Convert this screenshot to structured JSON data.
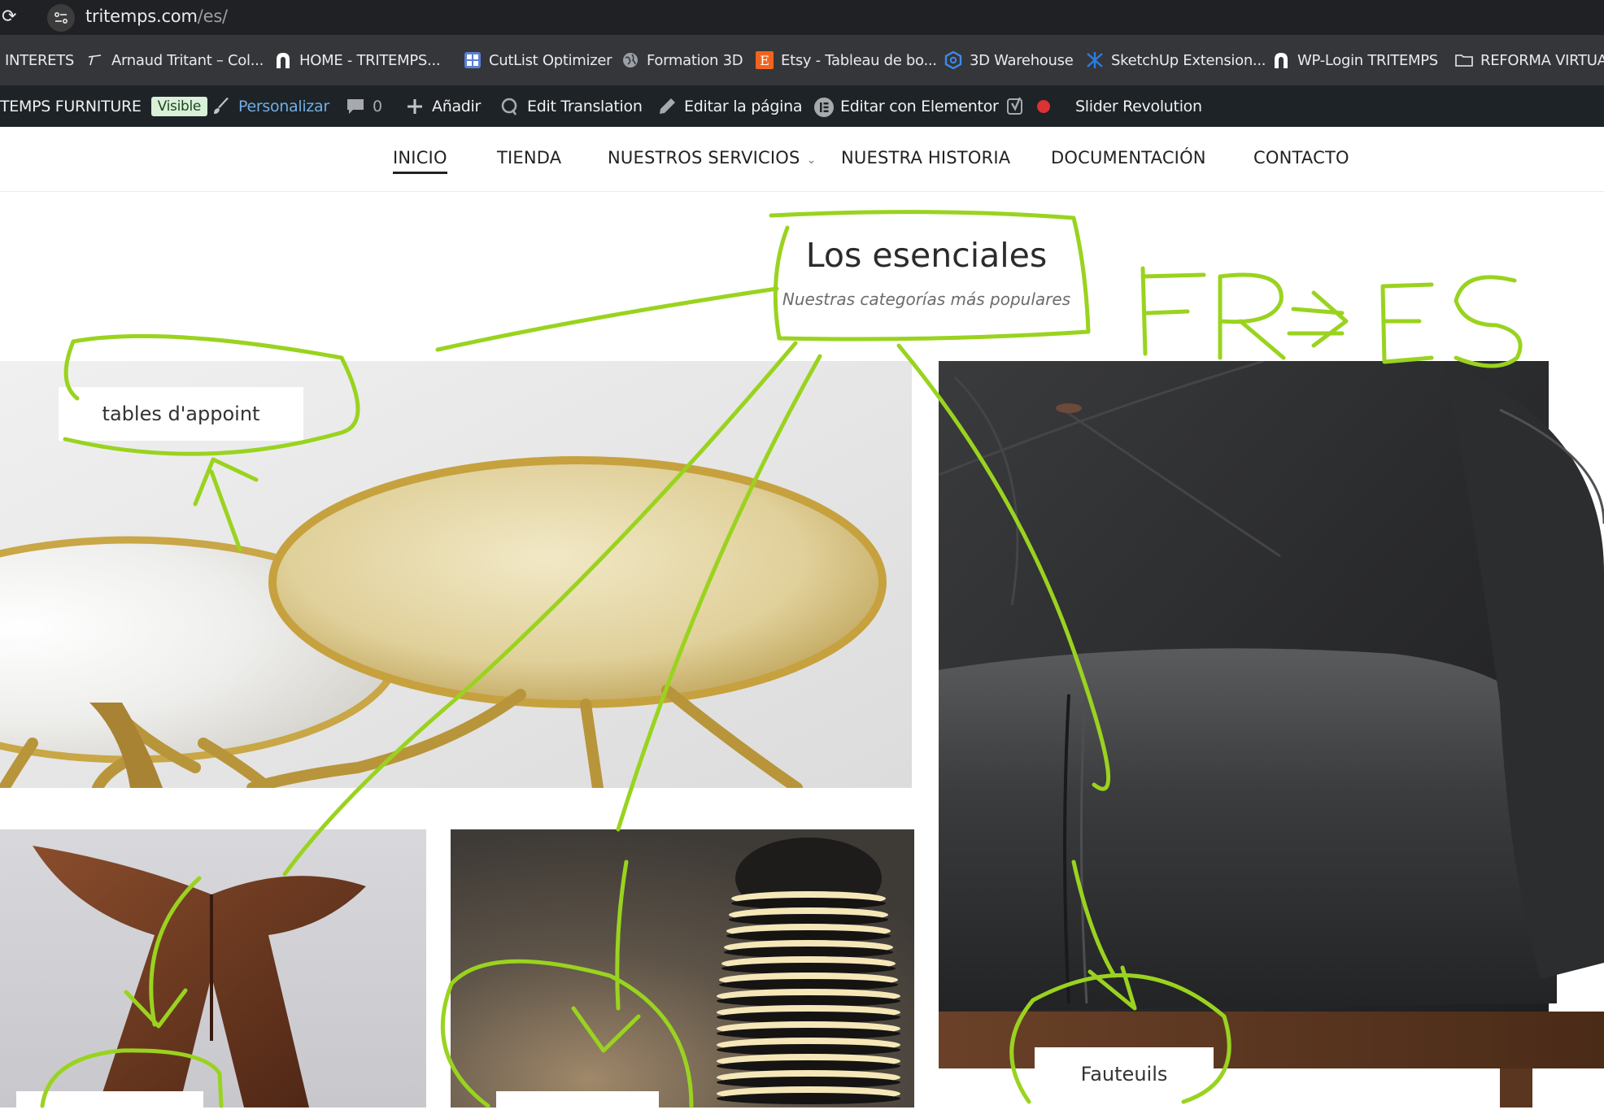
{
  "browser": {
    "url_host": "tritemps.com",
    "url_path": "/es/"
  },
  "bookmarks": [
    {
      "label": "INTERETS",
      "icon": "none"
    },
    {
      "label": "Arnaud Tritant – Col...",
      "icon": "signature-icon"
    },
    {
      "label": "HOME - TRITEMPS...",
      "icon": "tritemps-logo-icon"
    },
    {
      "label": "CutList Optimizer",
      "icon": "cutlist-icon"
    },
    {
      "label": "Formation 3D",
      "icon": "globe-icon"
    },
    {
      "label": "Etsy - Tableau de bo...",
      "icon": "etsy-icon"
    },
    {
      "label": "3D Warehouse",
      "icon": "warehouse-icon"
    },
    {
      "label": "SketchUp Extension...",
      "icon": "sketchup-icon"
    },
    {
      "label": "WP-Login TRITEMPS",
      "icon": "tritemps-logo-icon"
    },
    {
      "label": "REFORMA VIRTUAL",
      "icon": "folder-icon"
    }
  ],
  "adminbar": {
    "site_name": "TEMPS FURNITURE",
    "visible_badge": "Visible",
    "customize": "Personalizar",
    "comments_count": "0",
    "add_new": "Añadir",
    "edit_translation": "Edit Translation",
    "edit_page": "Editar la página",
    "edit_elementor": "Editar con Elementor",
    "slider": "Slider Revolution"
  },
  "nav": {
    "items": [
      "INICIO",
      "TIENDA",
      "NUESTROS SERVICIOS",
      "NUESTRA HISTORIA",
      "DOCUMENTACIÓN",
      "CONTACTO"
    ]
  },
  "section": {
    "title": "Los esenciales",
    "subtitle": "Nuestras categorías más populares"
  },
  "categories": {
    "side_tables": "tables d'appoint",
    "armchairs": "Fauteuils"
  },
  "annotation": {
    "handwritten_note": "FR→ES",
    "stroke_color": "#9ad31f"
  },
  "colors": {
    "urlbar_bg": "#202124",
    "bookmarks_bg": "#35363a",
    "adminbar_bg": "#1d2327",
    "customize_blue": "#72aee6"
  }
}
